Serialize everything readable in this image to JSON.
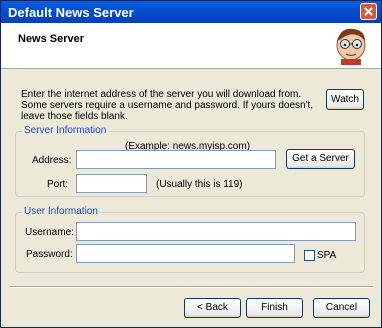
{
  "window": {
    "title": "Default News Server"
  },
  "header": {
    "title": "News Server",
    "icon": "cartoon-character-icon"
  },
  "intro": {
    "text": "Enter the internet address of the server you will download from.  Some servers require a username and password.  If yours doesn't, leave those fields blank."
  },
  "buttons": {
    "watch": "Watch",
    "get_server": "Get a Server",
    "back": "< Back",
    "finish": "Finish",
    "cancel": "Cancel"
  },
  "server_info": {
    "legend": "Server Information",
    "example": "(Example: news.myisp.com)",
    "address_label": "Address:",
    "address_value": "",
    "port_label": "Port:",
    "port_value": "",
    "port_hint": "(Usually this is 119)"
  },
  "user_info": {
    "legend": "User Information",
    "username_label": "Username:",
    "username_value": "",
    "password_label": "Password:",
    "password_value": "",
    "spa_label": "SPA",
    "spa_checked": false
  },
  "colors": {
    "titlebar": "#0450d0",
    "group_label": "#1f49cc",
    "dialog_bg": "#ece9d8"
  }
}
